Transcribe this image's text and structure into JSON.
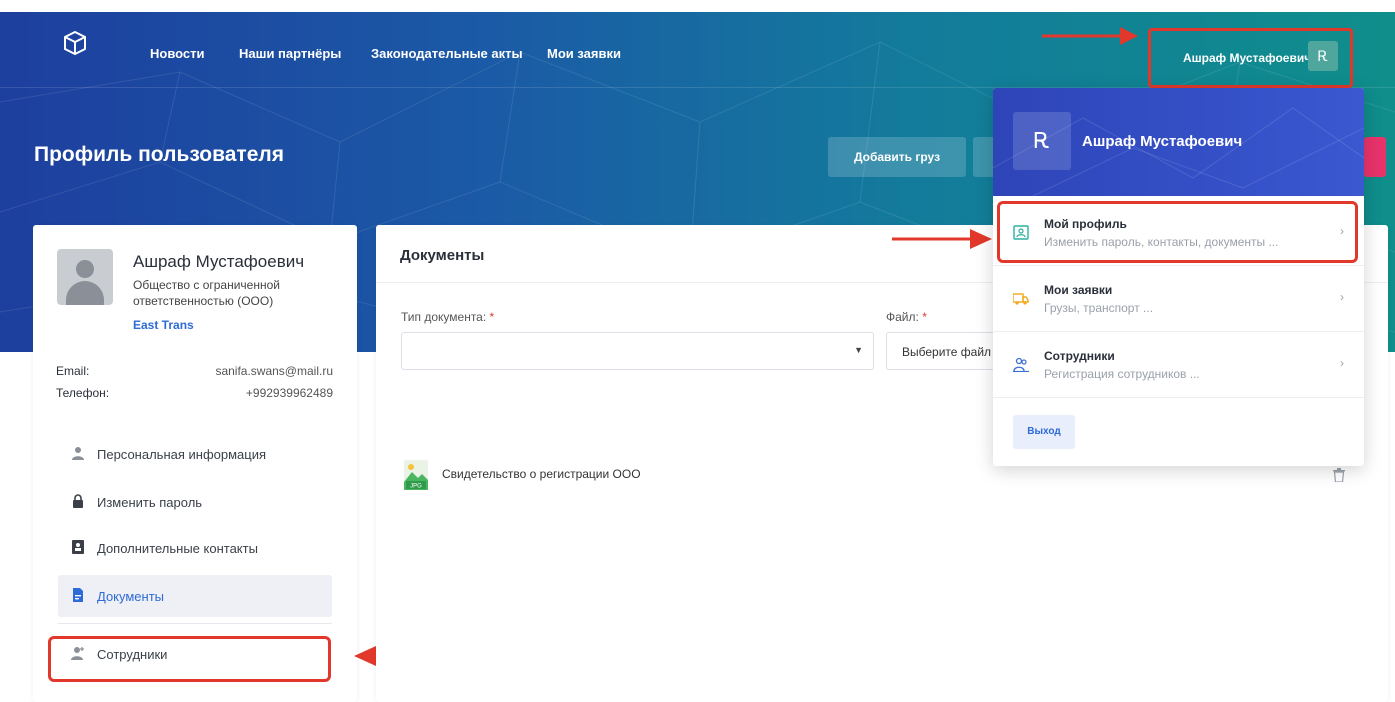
{
  "nav": {
    "links": [
      "Новости",
      "Наши партнёры",
      "Законодательные акты",
      "Мои заявки"
    ],
    "user_name": "Ашраф Мустафоевич",
    "avatar_glyph": "Ꭱ"
  },
  "hero": {
    "title": "Профиль пользователя",
    "add_cargo_button": "Добавить груз"
  },
  "profile": {
    "name": "Ашраф Мустафоевич",
    "org_type": "Общество с ограниченной ответственностью (ООО)",
    "company": "East Trans",
    "email_label": "Email:",
    "email": "sanifa.swans@mail.ru",
    "phone_label": "Телефон:",
    "phone": "+992939962489"
  },
  "sidebar": {
    "items": [
      {
        "label": "Персональная информация",
        "icon": "user-icon"
      },
      {
        "label": "Изменить пароль",
        "icon": "lock-icon"
      },
      {
        "label": "Дополнительные контакты",
        "icon": "contact-card-icon"
      },
      {
        "label": "Документы",
        "icon": "document-icon",
        "active": true
      },
      {
        "label": "Сотрудники",
        "icon": "add-user-icon"
      }
    ]
  },
  "documents": {
    "title": "Документы",
    "type_label": "Тип документа:",
    "required_mark": "*",
    "file_label": "Файл:",
    "file_placeholder": "Выберите файл",
    "uploaded": [
      {
        "name": "Свидетельство о регистрации ООО",
        "file_type": "JPG"
      }
    ]
  },
  "dropdown": {
    "name": "Ашраф Мустафоевич",
    "items": [
      {
        "title": "Мой профиль",
        "subtitle": "Изменить пароль, контакты, документы ...",
        "icon": "profile-card-icon"
      },
      {
        "title": "Мои заявки",
        "subtitle": "Грузы, транспорт ...",
        "icon": "truck-icon"
      },
      {
        "title": "Сотрудники",
        "subtitle": "Регистрация сотрудников ...",
        "icon": "employees-icon"
      }
    ],
    "logout_label": "Выход"
  },
  "colors": {
    "accent": "#2e6bd6",
    "highlight": "#e2382b",
    "hero_start": "#1d3f9e",
    "hero_end": "#0f8e8b"
  }
}
